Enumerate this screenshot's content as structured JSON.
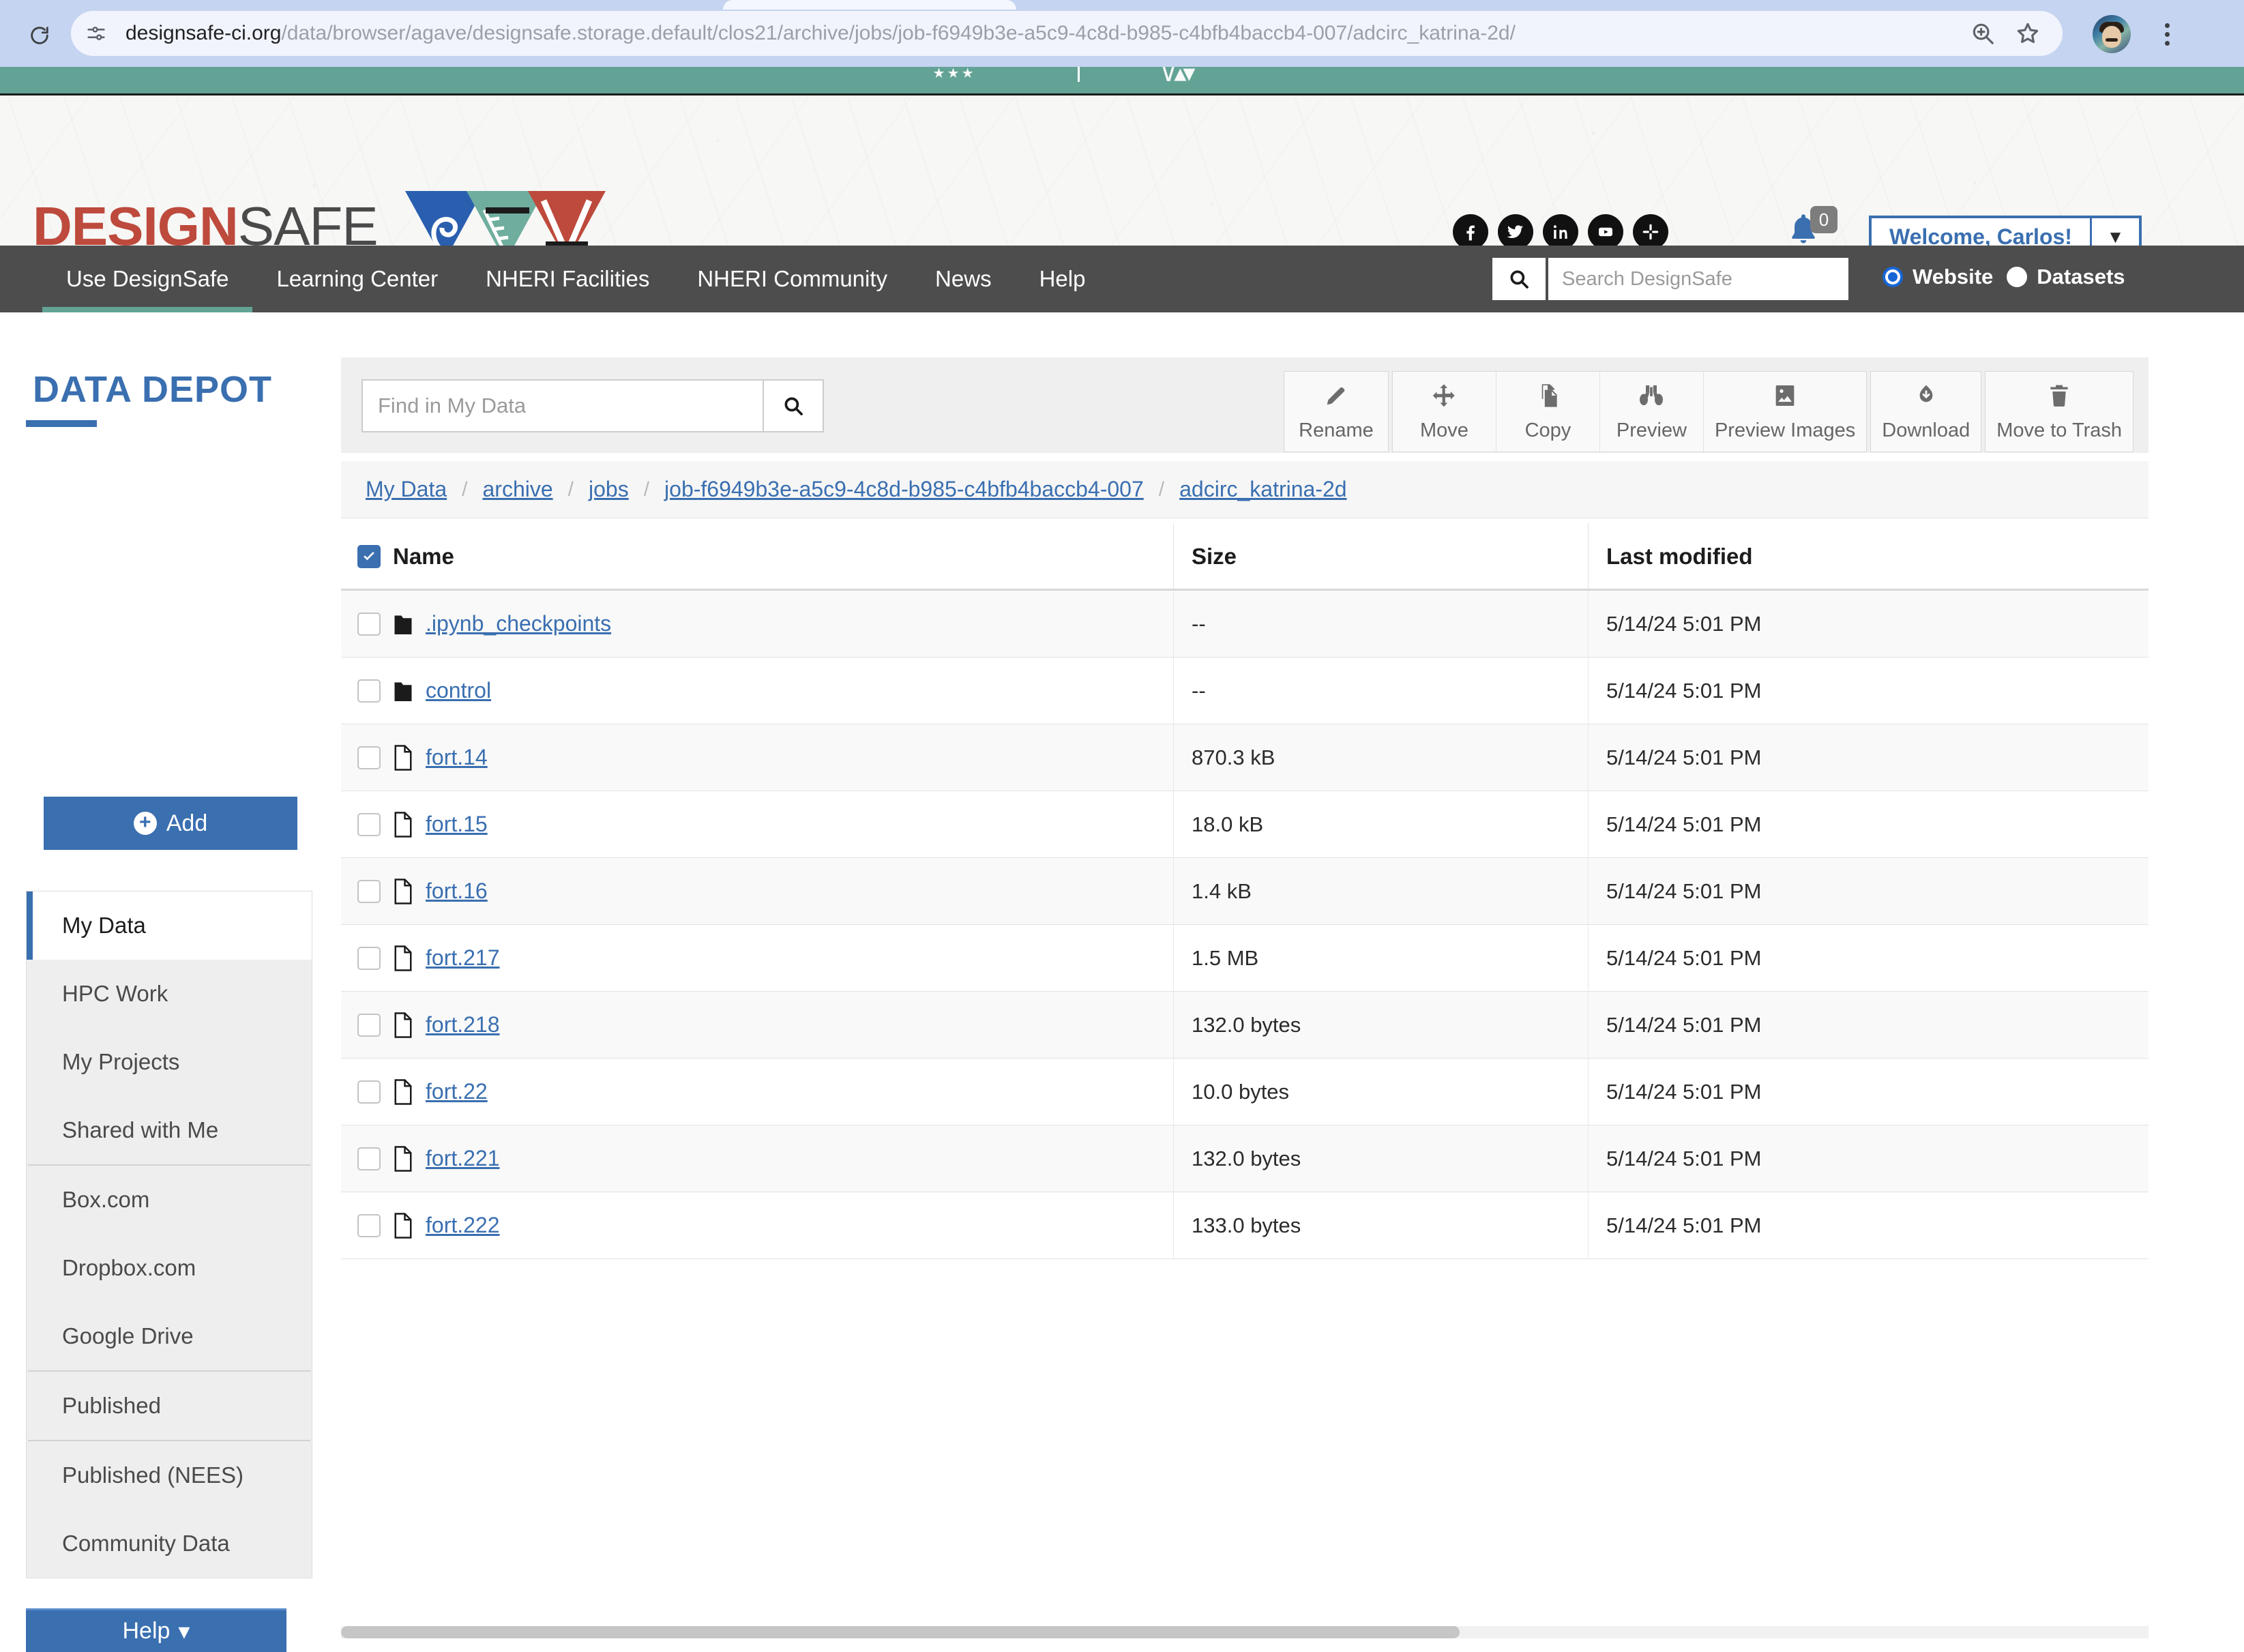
{
  "browser": {
    "url_host": "designsafe-ci.org",
    "url_path": "/data/browser/agave/designsafe.storage.default/clos21/archive/jobs/job-f6949b3e-a5c9-4c8d-b985-c4bfb4baccb4-007/adcirc_katrina-2d/",
    "reload_icon": "reload-icon",
    "site_info_icon": "site-settings-icon",
    "zoom_icon": "zoom-in-icon",
    "bookmark_icon": "bookmark-star-icon",
    "avatar_icon": "profile-avatar",
    "menu_icon": "three-dot-menu-icon"
  },
  "banner": {
    "logo_design": "DESIGN",
    "logo_safe": "SAFE",
    "social": [
      {
        "name": "facebook-icon",
        "label": "Facebook"
      },
      {
        "name": "twitter-icon",
        "label": "Twitter"
      },
      {
        "name": "linkedin-icon",
        "label": "LinkedIn"
      },
      {
        "name": "youtube-icon",
        "label": "YouTube"
      },
      {
        "name": "slack-icon",
        "label": "Slack"
      }
    ],
    "notification_count": "0",
    "welcome_label": "Welcome, Carlos!",
    "welcome_caret": "▼"
  },
  "nav": {
    "items": [
      {
        "label": "Use DesignSafe",
        "active": true
      },
      {
        "label": "Learning Center",
        "active": false
      },
      {
        "label": "NHERI Facilities",
        "active": false
      },
      {
        "label": "NHERI Community",
        "active": false
      },
      {
        "label": "News",
        "active": false
      },
      {
        "label": "Help",
        "active": false
      }
    ],
    "search_placeholder": "Search DesignSafe",
    "search_value": "",
    "scope_options": [
      {
        "label": "Website",
        "checked": true
      },
      {
        "label": "Datasets",
        "checked": false
      }
    ]
  },
  "sidebar": {
    "title": "DATA DEPOT",
    "add_label": "Add",
    "help_label": "Help",
    "help_caret": "▾",
    "groups": [
      {
        "items": [
          {
            "label": "My Data",
            "active": true
          },
          {
            "label": "HPC Work",
            "active": false
          },
          {
            "label": "My Projects",
            "active": false
          },
          {
            "label": "Shared with Me",
            "active": false
          }
        ]
      },
      {
        "items": [
          {
            "label": "Box.com",
            "active": false
          },
          {
            "label": "Dropbox.com",
            "active": false
          },
          {
            "label": "Google Drive",
            "active": false
          }
        ]
      },
      {
        "items": [
          {
            "label": "Published",
            "active": false
          }
        ]
      },
      {
        "items": [
          {
            "label": "Published (NEES)",
            "active": false
          },
          {
            "label": "Community Data",
            "active": false
          }
        ]
      }
    ]
  },
  "toolbar": {
    "find_placeholder": "Find in My Data",
    "find_value": "",
    "groups": [
      [
        {
          "label": "Rename",
          "icon": "pencil-icon"
        }
      ],
      [
        {
          "label": "Move",
          "icon": "move-arrows-icon"
        },
        {
          "label": "Copy",
          "icon": "copy-icon"
        },
        {
          "label": "Preview",
          "icon": "binoculars-icon"
        },
        {
          "label": "Preview Images",
          "icon": "image-icon"
        }
      ],
      [
        {
          "label": "Download",
          "icon": "cloud-download-icon"
        }
      ],
      [
        {
          "label": "Move to Trash",
          "icon": "trash-icon"
        }
      ]
    ]
  },
  "breadcrumb": [
    "My Data",
    "archive",
    "jobs",
    "job-f6949b3e-a5c9-4c8d-b985-c4bfb4baccb4-007",
    "adcirc_katrina-2d"
  ],
  "table": {
    "select_all_checked": true,
    "columns": [
      "Name",
      "Size",
      "Last modified"
    ],
    "rows": [
      {
        "name": ".ipynb_checkpoints",
        "type": "folder",
        "size": "--",
        "modified": "5/14/24 5:01 PM"
      },
      {
        "name": "control",
        "type": "folder",
        "size": "--",
        "modified": "5/14/24 5:01 PM"
      },
      {
        "name": "fort.14",
        "type": "file",
        "size": "870.3 kB",
        "modified": "5/14/24 5:01 PM"
      },
      {
        "name": "fort.15",
        "type": "file",
        "size": "18.0 kB",
        "modified": "5/14/24 5:01 PM"
      },
      {
        "name": "fort.16",
        "type": "file",
        "size": "1.4 kB",
        "modified": "5/14/24 5:01 PM"
      },
      {
        "name": "fort.217",
        "type": "file",
        "size": "1.5 MB",
        "modified": "5/14/24 5:01 PM"
      },
      {
        "name": "fort.218",
        "type": "file",
        "size": "132.0 bytes",
        "modified": "5/14/24 5:01 PM"
      },
      {
        "name": "fort.22",
        "type": "file",
        "size": "10.0 bytes",
        "modified": "5/14/24 5:01 PM"
      },
      {
        "name": "fort.221",
        "type": "file",
        "size": "132.0 bytes",
        "modified": "5/14/24 5:01 PM"
      },
      {
        "name": "fort.222",
        "type": "file",
        "size": "133.0 bytes",
        "modified": "5/14/24 5:01 PM"
      }
    ]
  },
  "colors": {
    "brand_red": "#bd4a3c",
    "brand_blue": "#3a6fb0",
    "teal": "#63a396",
    "nav_gray": "#4d4d4d",
    "link_blue": "#3a6fb0"
  }
}
